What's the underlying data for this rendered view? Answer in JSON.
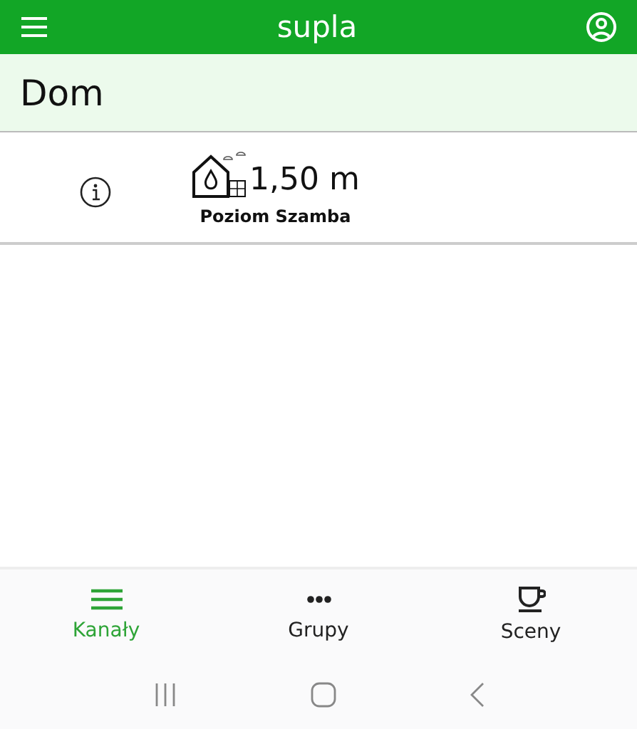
{
  "app_bar": {
    "title": "supla"
  },
  "location": {
    "name": "Dom"
  },
  "channels": [
    {
      "value": "1,50 m",
      "caption": "Poziom Szamba"
    }
  ],
  "tabs": [
    {
      "label": "Kanały",
      "kind": "list",
      "selected": true
    },
    {
      "label": "Grupy",
      "kind": "dots",
      "selected": false
    },
    {
      "label": "Sceny",
      "kind": "cup",
      "selected": false
    }
  ]
}
